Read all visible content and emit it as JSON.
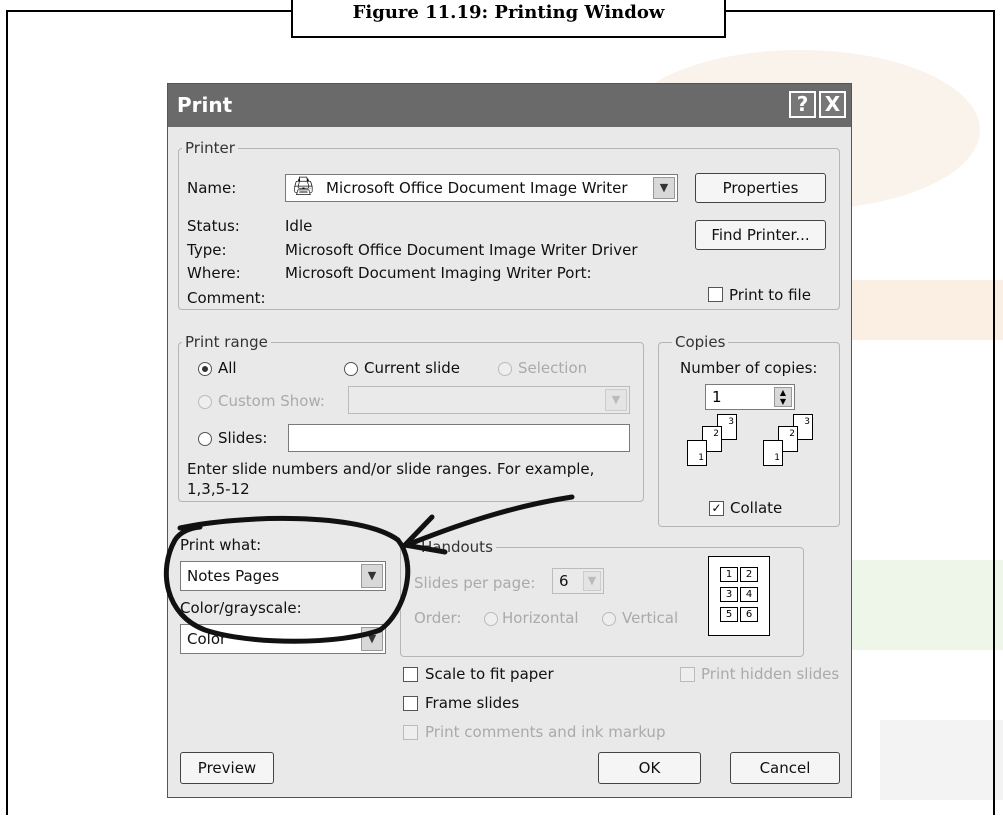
{
  "caption": "Figure 11.19: Printing Window",
  "dialog": {
    "title": "Print",
    "help_button": "?",
    "close_button": "X"
  },
  "printer": {
    "group_label": "Printer",
    "name_label": "Name:",
    "name_value": "Microsoft Office Document Image Writer",
    "status_label": "Status:",
    "status_value": "Idle",
    "type_label": "Type:",
    "type_value": "Microsoft Office Document Image Writer Driver",
    "where_label": "Where:",
    "where_value": "Microsoft Document Imaging Writer Port:",
    "comment_label": "Comment:",
    "properties_button": "Properties",
    "find_printer_button": "Find Printer...",
    "print_to_file_label": "Print to file",
    "print_to_file_checked": false
  },
  "print_range": {
    "group_label": "Print range",
    "all_label": "All",
    "current_slide_label": "Current slide",
    "selection_label": "Selection",
    "custom_show_label": "Custom Show:",
    "slides_label": "Slides:",
    "hint": "Enter slide numbers and/or slide ranges. For example,",
    "hint_example": "1,3,5-12",
    "selected": "All"
  },
  "copies": {
    "group_label": "Copies",
    "number_label": "Number of copies:",
    "number_value": "1",
    "collate_label": "Collate",
    "collate_checked": true,
    "icon_pages": [
      "1",
      "2",
      "3"
    ]
  },
  "print_what": {
    "label": "Print what:",
    "value": "Notes Pages"
  },
  "color": {
    "label": "Color/grayscale:",
    "value": "Color"
  },
  "handouts": {
    "group_label": "Handouts",
    "slides_per_page_label": "Slides per page:",
    "slides_per_page_value": "6",
    "order_label": "Order:",
    "horizontal_label": "Horizontal",
    "vertical_label": "Vertical",
    "grid_numbers": [
      "1",
      "2",
      "3",
      "4",
      "5",
      "6"
    ]
  },
  "options": {
    "scale_to_fit_label": "Scale to fit paper",
    "frame_slides_label": "Frame slides",
    "print_comments_label": "Print comments and ink markup",
    "print_hidden_label": "Print hidden slides"
  },
  "footer": {
    "preview_button": "Preview",
    "ok_button": "OK",
    "cancel_button": "Cancel"
  }
}
